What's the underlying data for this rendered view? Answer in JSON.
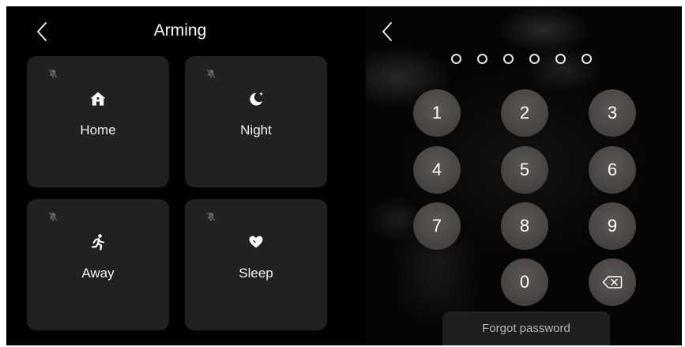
{
  "arming": {
    "title": "Arming",
    "modes": [
      {
        "label": "Home",
        "icon": "home-icon"
      },
      {
        "label": "Night",
        "icon": "moon-icon"
      },
      {
        "label": "Away",
        "icon": "running-person-icon"
      },
      {
        "label": "Sleep",
        "icon": "heart-icon"
      }
    ],
    "status_icon": "bell-off-icon"
  },
  "keypad": {
    "pin_length": 6,
    "keys": [
      "1",
      "2",
      "3",
      "4",
      "5",
      "6",
      "7",
      "8",
      "9",
      "0"
    ],
    "backspace_icon": "backspace-icon",
    "forgot_label": "Forgot password"
  },
  "colors": {
    "background": "#000000",
    "card": "#212121",
    "key": "#4a4542",
    "text": "#ffffff"
  }
}
